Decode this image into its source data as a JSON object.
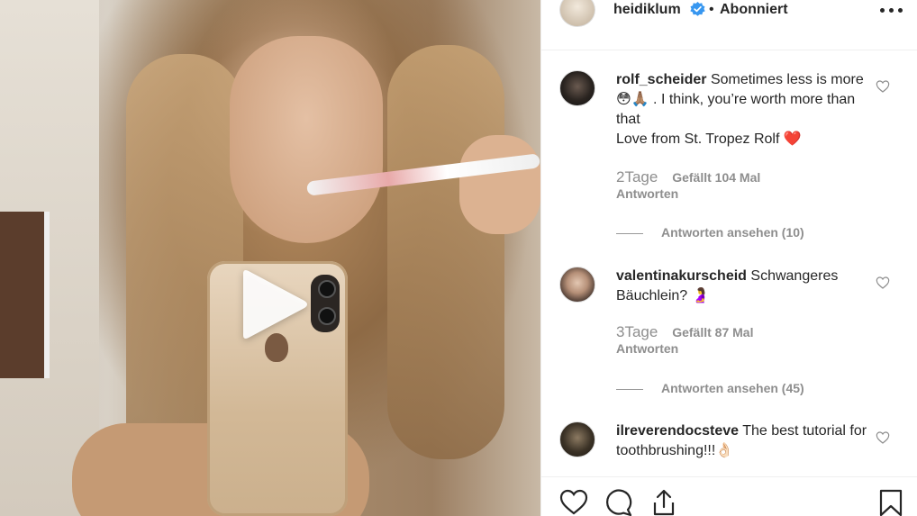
{
  "post": {
    "author": "heidiklum",
    "follow_status": "Abonniert",
    "dot": "•"
  },
  "comments": [
    {
      "user": "rolf_scheider",
      "text_line1": "Sometimes less is more 😳🙏🏽 . I think, you’re worth more than that",
      "text_line2": "Love from St. Tropez Rolf ❤️",
      "time": "2Tage",
      "likes": "Gefällt 104 Mal",
      "reply_label": "Antworten",
      "view_replies": "Antworten ansehen (10)"
    },
    {
      "user": "valentinakurscheid",
      "text_line1": "Schwangeres Bäuchlein? 🤰",
      "time": "3Tage",
      "likes": "Gefällt 87 Mal",
      "reply_label": "Antworten",
      "view_replies": "Antworten ansehen (45)"
    },
    {
      "user": "ilreverendocsteve",
      "text_line1": "The best tutorial for toothbrushing!!!👌🏻"
    }
  ],
  "icons": {
    "play": "play-icon",
    "verified": "verified-badge-icon",
    "more": "more-options-icon",
    "heart": "heart-icon",
    "comment": "comment-icon",
    "share": "share-icon",
    "bookmark": "bookmark-icon"
  },
  "colors": {
    "verified_blue": "#3897f0",
    "text_primary": "#262626",
    "text_secondary": "#8e8e8e"
  }
}
